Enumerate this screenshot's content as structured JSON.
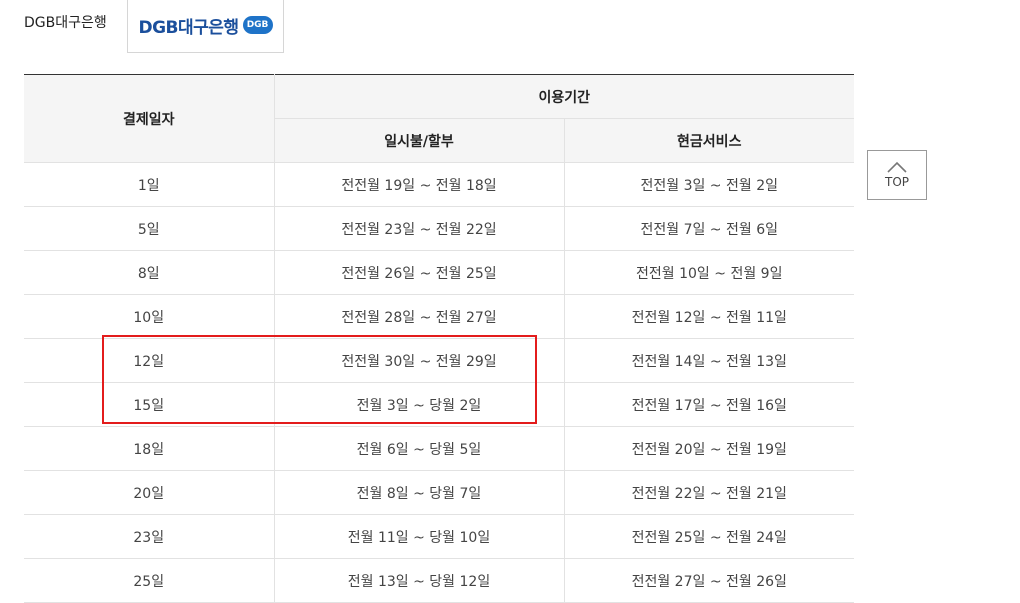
{
  "bank": {
    "tab_label": "DGB대구은행",
    "logo_text": "DGB대구은행",
    "logo_badge": "DGB"
  },
  "table": {
    "header_payment_day": "결제일자",
    "header_usage_period": "이용기간",
    "header_lump_installment": "일시불/할부",
    "header_cash_service": "현금서비스",
    "rows": [
      {
        "day": "1일",
        "lump": "전전월 19일 ~ 전월 18일",
        "cash": "전전월 3일 ~ 전월 2일"
      },
      {
        "day": "5일",
        "lump": "전전월 23일 ~ 전월 22일",
        "cash": "전전월 7일 ~ 전월 6일"
      },
      {
        "day": "8일",
        "lump": "전전월 26일 ~ 전월 25일",
        "cash": "전전월 10일 ~ 전월 9일"
      },
      {
        "day": "10일",
        "lump": "전전월 28일 ~ 전월 27일",
        "cash": "전전월 12일 ~ 전월 11일"
      },
      {
        "day": "12일",
        "lump": "전전월 30일 ~ 전월 29일",
        "cash": "전전월 14일 ~ 전월 13일"
      },
      {
        "day": "15일",
        "lump": "전월 3일 ~ 당월 2일",
        "cash": "전전월 17일 ~ 전월 16일"
      },
      {
        "day": "18일",
        "lump": "전월 6일 ~ 당월 5일",
        "cash": "전전월 20일 ~ 전월 19일"
      },
      {
        "day": "20일",
        "lump": "전월 8일 ~ 당월 7일",
        "cash": "전전월 22일 ~ 전월 21일"
      },
      {
        "day": "23일",
        "lump": "전월 11일 ~ 당월 10일",
        "cash": "전전월 25일 ~ 전월 24일"
      },
      {
        "day": "25일",
        "lump": "전월 13일 ~ 당월 12일",
        "cash": "전전월 27일 ~ 전월 26일"
      }
    ]
  },
  "top_button": {
    "label": "TOP",
    "icon": "chevron-up-icon"
  },
  "colors": {
    "highlight": "#e31c1c",
    "logo_blue": "#1b4f9c",
    "header_bg": "#f5f5f5"
  }
}
